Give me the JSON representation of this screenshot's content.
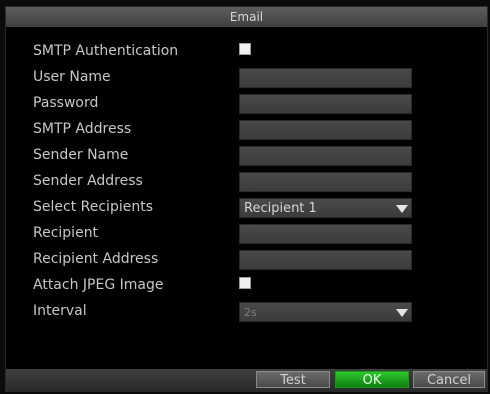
{
  "window": {
    "title": "Email"
  },
  "form": {
    "rows": [
      {
        "label": "SMTP Authentication",
        "control": "checkbox",
        "checked": true
      },
      {
        "label": "User Name",
        "control": "text",
        "value": ""
      },
      {
        "label": "Password",
        "control": "text",
        "value": ""
      },
      {
        "label": "SMTP Address",
        "control": "text",
        "value": ""
      },
      {
        "label": "Sender Name",
        "control": "text",
        "value": ""
      },
      {
        "label": "Sender Address",
        "control": "text",
        "value": ""
      },
      {
        "label": "Select Recipients",
        "control": "select",
        "value": "Recipient 1"
      },
      {
        "label": "Recipient",
        "control": "text",
        "value": ""
      },
      {
        "label": "Recipient Address",
        "control": "text",
        "value": ""
      },
      {
        "label": "Attach JPEG Image",
        "control": "checkbox",
        "checked": true
      },
      {
        "label": "Interval",
        "control": "select",
        "value": "2s"
      }
    ]
  },
  "footer": {
    "test_label": "Test",
    "ok_label": "OK",
    "cancel_label": "Cancel"
  },
  "icons": {
    "dropdown": "chevron-down-icon"
  },
  "colors": {
    "ok_button": "#1fa51f",
    "background": "#000000",
    "field": "#444444"
  }
}
